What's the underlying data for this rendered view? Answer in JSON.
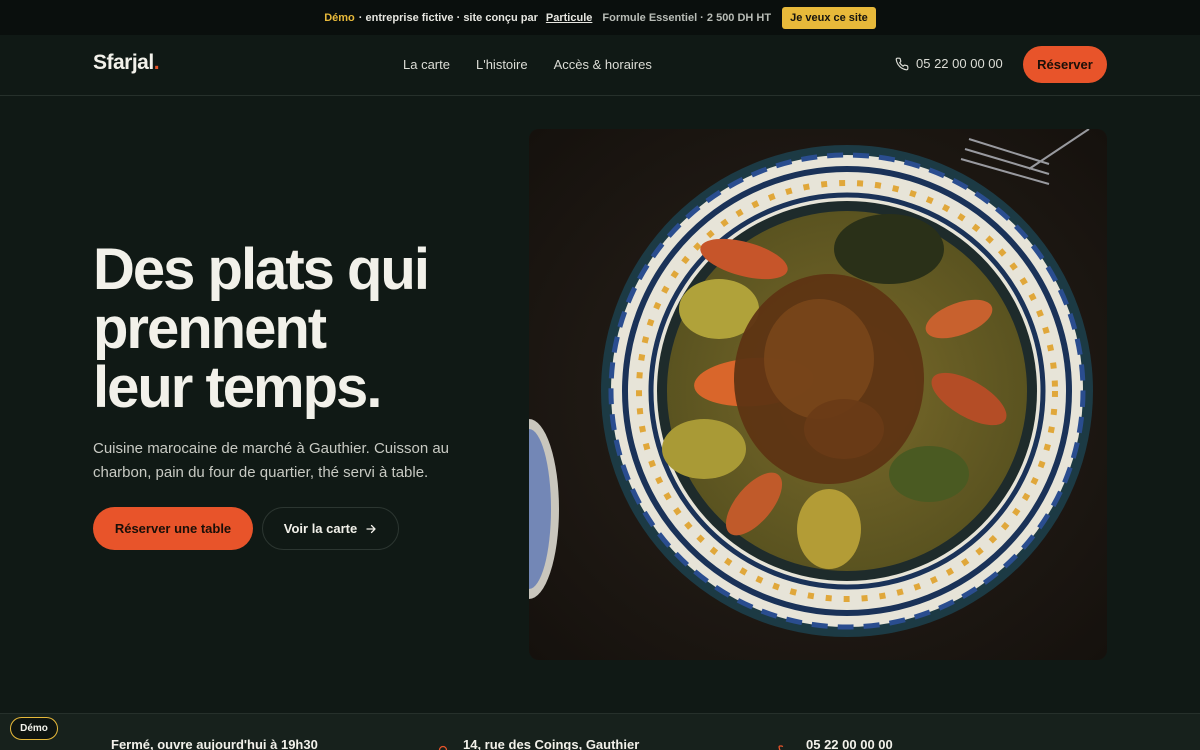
{
  "demo_bar": {
    "demo_word": "Démo",
    "text_1": "· entreprise fictive · site conçu par",
    "link": "Particule",
    "formule": "Formule Essentiel · 2 500 DH HT",
    "cta": "Je veux ce site"
  },
  "header": {
    "logo": "Sfarjal",
    "logo_dot": ".",
    "nav": [
      "La carte",
      "L'histoire",
      "Accès & horaires"
    ],
    "phone": "05 22 00 00 00",
    "reserve": "Réserver"
  },
  "hero": {
    "title_lines": [
      "Des plats qui",
      "prennent",
      "leur temps."
    ],
    "subtitle": "Cuisine marocaine de marché à Gauthier. Cuisson au charbon, pain du four de quartier, thé servi à table.",
    "primary_button": "Réserver une table",
    "secondary_button": "Voir la carte"
  },
  "info": {
    "hours": "Fermé, ouvre aujourd'hui à 19h30",
    "address": "14, rue des Coings, Gauthier",
    "phone": "05 22 00 00 00"
  },
  "badge": "Démo",
  "colors": {
    "accent": "#e8542a",
    "demo_yellow": "#e7b93a",
    "background": "#101915"
  },
  "icons": {
    "phone": "phone-icon",
    "arrow": "arrow-right-icon",
    "location": "location-pin-icon",
    "clock": "clock-icon"
  }
}
